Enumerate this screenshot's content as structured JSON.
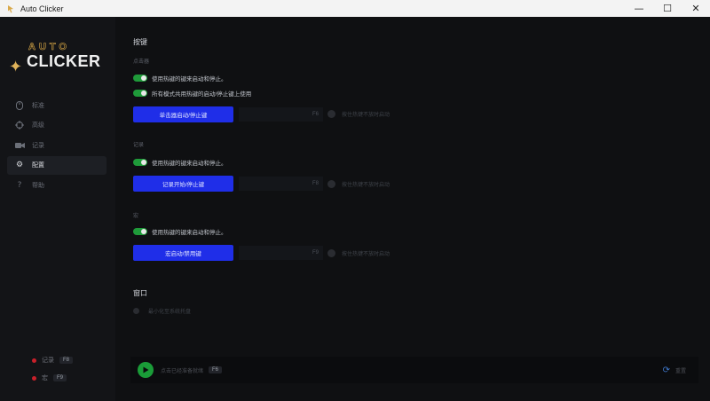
{
  "window": {
    "title": "Auto Clicker",
    "minimize": "—",
    "maximize": "☐",
    "close": "✕"
  },
  "logo": {
    "line1": "AUTO",
    "line2": "CLICKER"
  },
  "nav": {
    "items": [
      {
        "label": "标准"
      },
      {
        "label": "高级"
      },
      {
        "label": "记录"
      },
      {
        "label": "配置"
      },
      {
        "label": "帮助"
      }
    ]
  },
  "sidebar_hotkeys": [
    {
      "label": "记录",
      "key": "F8"
    },
    {
      "label": "宏",
      "key": "F9"
    }
  ],
  "main": {
    "section_keys": "按键",
    "clicker": {
      "label": "点击器",
      "toggle1": "使用热键的键来启动和停止。",
      "toggle2": "所有模式共用热键的启动/停止键上使用",
      "button": "单击器启动/停止键",
      "key": "F6",
      "check": "按住热键不放时启动"
    },
    "record": {
      "label": "记录",
      "toggle1": "使用热键的键来启动和停止。",
      "button": "记录开始/停止键",
      "key": "F8",
      "check": "按住热键不放时启动"
    },
    "macro": {
      "label": "宏",
      "toggle1": "使用热键的键来启动和停止。",
      "button": "宏启动/禁用键",
      "key": "F9",
      "check": "按住热键不放时启动"
    },
    "section_window": "窗口",
    "window_option": "最小化至系统托盘"
  },
  "footer": {
    "status": "点击已经准备就绪",
    "key": "F6",
    "reset": "重置"
  },
  "colors": {
    "accent_blue": "#1f2ee8",
    "toggle_green": "#1f9b3a",
    "record_red": "#c8202a"
  }
}
